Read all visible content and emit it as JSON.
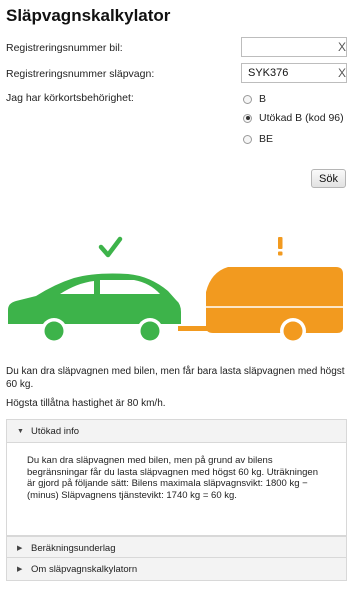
{
  "page_title": "Släpvagnskalkylator",
  "form": {
    "car_reg_label": "Registreringsnummer bil:",
    "car_reg_value": "",
    "trailer_reg_label": "Registreringsnummer släpvagn:",
    "trailer_reg_value": "SYK376",
    "clear_glyph": "X",
    "license_label": "Jag har körkortsbehörighet:",
    "license_options": [
      "B",
      "Utökad B (kod 96)",
      "BE"
    ],
    "license_selected": "Utökad B (kod 96)",
    "search_button": "Sök"
  },
  "illustration": {
    "car_status_icon": "check-icon",
    "trailer_status_icon": "exclamation-icon",
    "car_color": "#3db34a",
    "trailer_color": "#f29a1f"
  },
  "result": {
    "message": "Du kan dra släpvagnen med bilen, men får bara lasta släpvagnen med högst 60 kg.",
    "speed": "Högsta tillåtna hastighet är 80 km/h."
  },
  "sections": {
    "extended_info": {
      "title": "Utökad info",
      "expanded": true,
      "body": "Du kan dra släpvagnen med bilen, men på grund av bilens begränsningar får du lasta släpvagnen med högst 60 kg. Uträkningen är gjord på följande sätt: Bilens maximala släpvagnsvikt: 1800 kg − (minus) Släpvagnens tjänstevikt: 1740 kg = 60 kg."
    },
    "calc_basis": {
      "title": "Beräkningsunderlag",
      "expanded": false
    },
    "about": {
      "title": "Om släpvagnskalkylatorn",
      "expanded": false
    }
  }
}
